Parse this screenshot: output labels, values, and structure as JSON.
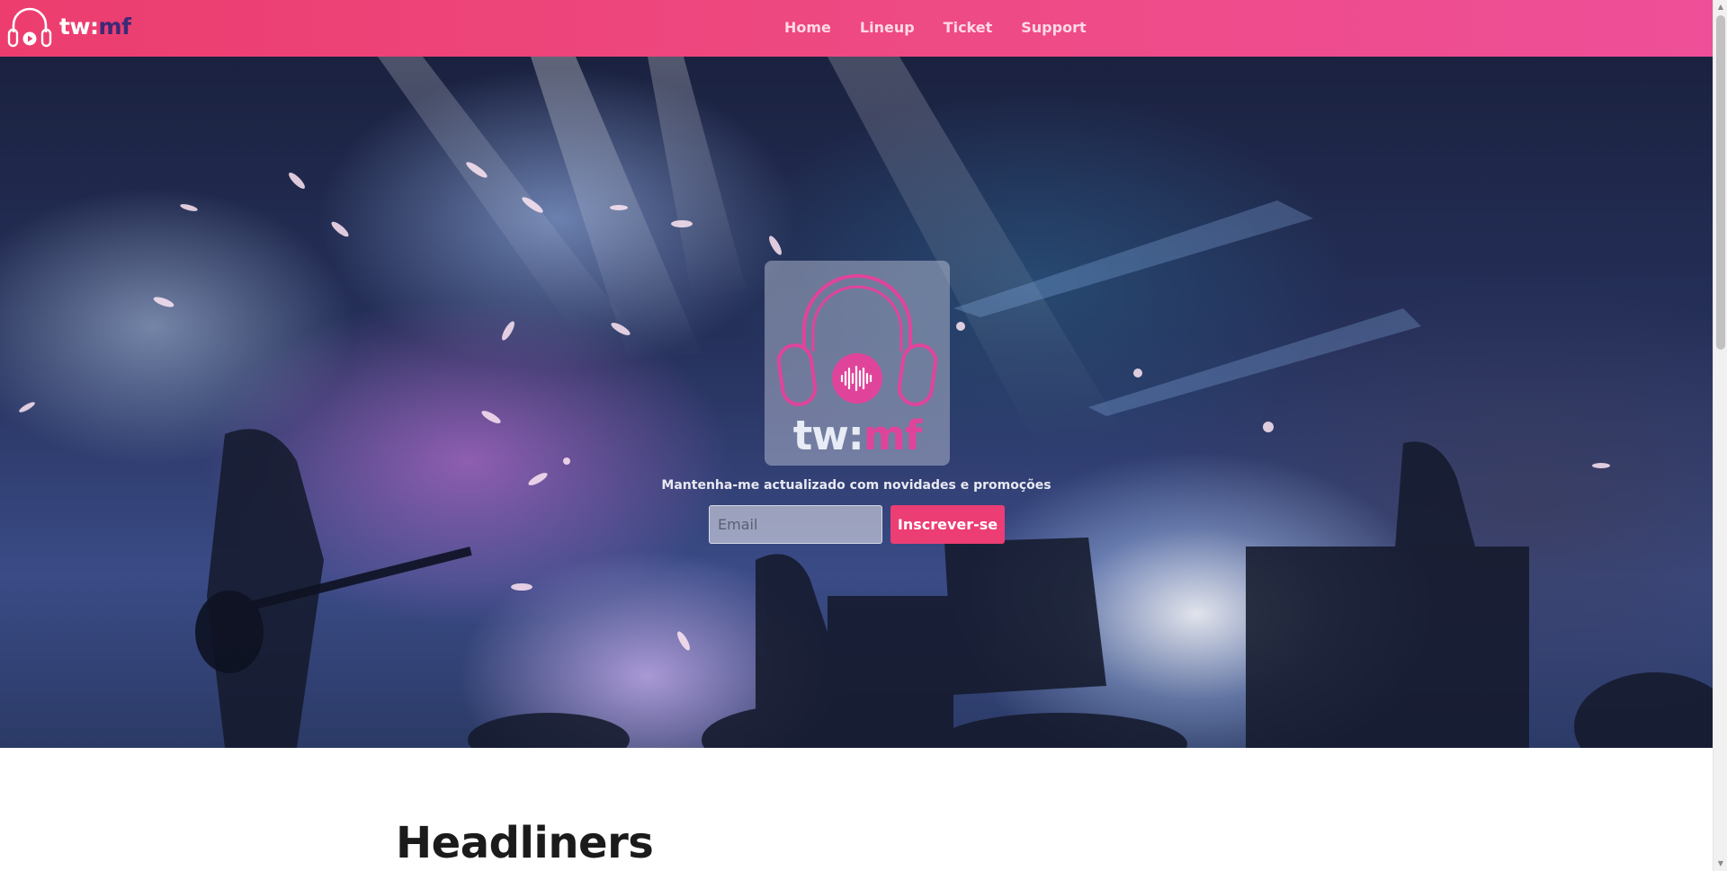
{
  "navbar": {
    "brand_prefix": "tw:",
    "brand_suffix": "mf",
    "links": [
      {
        "label": "Home"
      },
      {
        "label": "Lineup"
      },
      {
        "label": "Ticket"
      },
      {
        "label": "Support"
      }
    ],
    "accent_color": "#ec3d6e",
    "brand_dark_color": "#3b2a78"
  },
  "hero": {
    "card_brand_prefix": "tw:",
    "card_brand_suffix": "mf",
    "logo_icon": "headphones-soundwave-icon",
    "subscribe_text": "Mantenha-me actualizado com novidades e promoções",
    "email_placeholder": "Email",
    "email_value": "",
    "subscribe_button": "Inscrever-se",
    "button_color": "#ec3d74"
  },
  "headliners": {
    "title": "Headliners"
  },
  "icons": {
    "scroll_up": "▲",
    "scroll_down": "▼"
  }
}
